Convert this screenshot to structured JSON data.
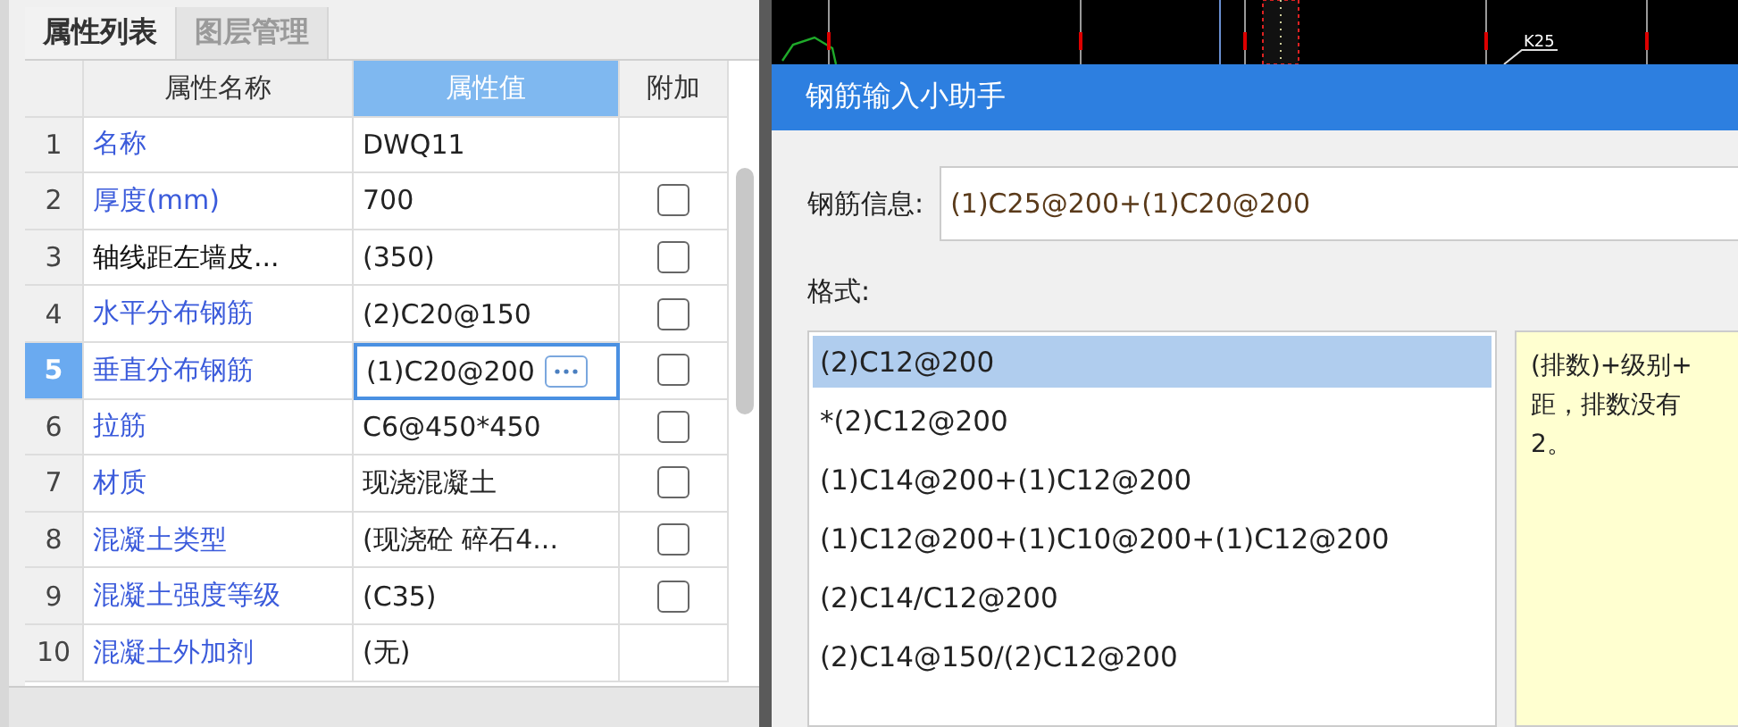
{
  "tabs": [
    {
      "label": "属性列表",
      "selected": true
    },
    {
      "label": "图层管理",
      "selected": false
    }
  ],
  "table": {
    "columns": [
      {
        "label": "属性名称",
        "selected": false
      },
      {
        "label": "属性值",
        "selected": true
      },
      {
        "label": "附加",
        "selected": false
      }
    ],
    "rows": [
      {
        "index": "1",
        "name": "名称",
        "value": "DWQ11",
        "public": true,
        "selected": false,
        "has_checkbox": false
      },
      {
        "index": "2",
        "name": "厚度(mm)",
        "value": "700",
        "public": true,
        "selected": false,
        "has_checkbox": true,
        "checked": false
      },
      {
        "index": "3",
        "name": "轴线距左墙皮...",
        "value": "(350)",
        "public": false,
        "selected": false,
        "has_checkbox": true,
        "checked": false
      },
      {
        "index": "4",
        "name": "水平分布钢筋",
        "value": "(2)C20@150",
        "public": true,
        "selected": false,
        "has_checkbox": true,
        "checked": false
      },
      {
        "index": "5",
        "name": "垂直分布钢筋",
        "value": "(1)C20@200",
        "public": true,
        "selected": true,
        "has_checkbox": true,
        "checked": false
      },
      {
        "index": "6",
        "name": "拉筋",
        "value": "C6@450*450",
        "public": true,
        "selected": false,
        "has_checkbox": true,
        "checked": false
      },
      {
        "index": "7",
        "name": "材质",
        "value": "现浇混凝土",
        "public": true,
        "selected": false,
        "has_checkbox": true,
        "checked": false
      },
      {
        "index": "8",
        "name": "混凝土类型",
        "value": "(现浇砼 碎石4...",
        "public": true,
        "selected": false,
        "has_checkbox": true,
        "checked": false
      },
      {
        "index": "9",
        "name": "混凝土强度等级",
        "value": "(C35)",
        "public": true,
        "selected": false,
        "has_checkbox": true,
        "checked": false
      },
      {
        "index": "10",
        "name": "混凝土外加剂",
        "value": "(无)",
        "public": true,
        "selected": false,
        "has_checkbox": false
      }
    ]
  },
  "dialog": {
    "title": "钢筋输入小助手",
    "info_label": "钢筋信息:",
    "info_value": "(1)C25@200+(1)C20@200",
    "format_label": "格式:",
    "formats": [
      {
        "text": "(2)C12@200",
        "selected": true
      },
      {
        "text": "*(2)C12@200",
        "selected": false
      },
      {
        "text": "(1)C14@200+(1)C12@200",
        "selected": false
      },
      {
        "text": "(1)C12@200+(1)C10@200+(1)C12@200",
        "selected": false
      },
      {
        "text": "(2)C14/C12@200",
        "selected": false
      },
      {
        "text": "(2)C14@150/(2)C12@200",
        "selected": false
      }
    ],
    "hint_lines": [
      "(排数)+级别+",
      "距，排数没有",
      "2。"
    ]
  },
  "cad_label": "K25"
}
